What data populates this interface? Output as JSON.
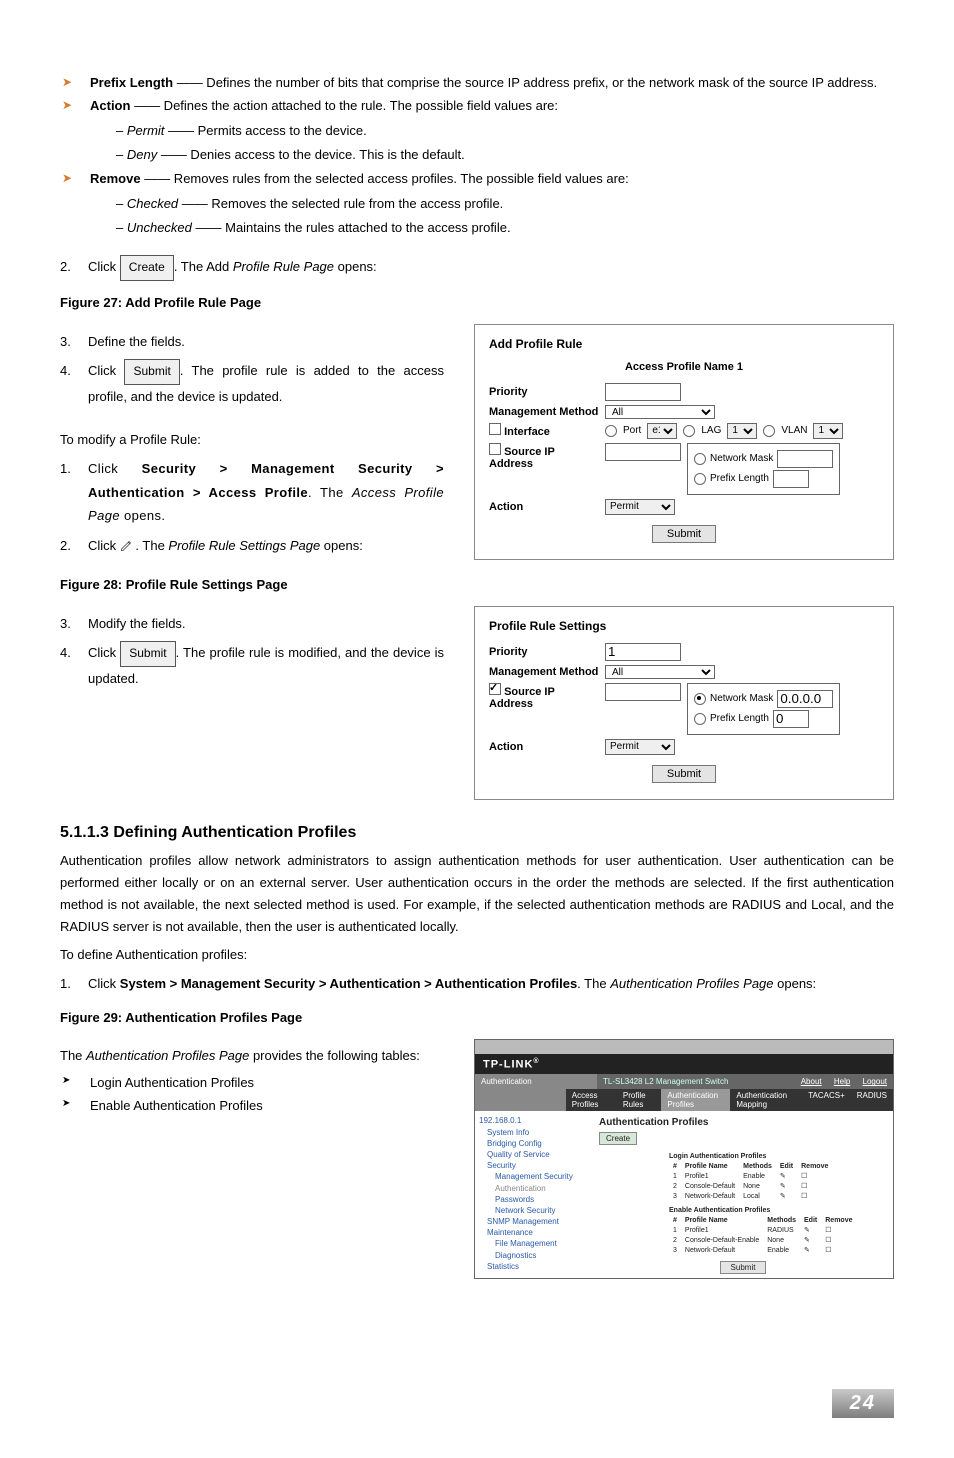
{
  "bullets": {
    "prefix_length_label": "Prefix Length",
    "prefix_length_text": " —— Defines the number of bits that comprise the source IP address prefix, or the network mask of the source IP address.",
    "action_label": "Action",
    "action_text": " —— Defines the action attached to the rule. The possible field values are:",
    "permit_line": "– Permit —— Permits access to the device.",
    "deny_line": "– Deny —— Denies access to the device. This is the default.",
    "remove_label": "Remove",
    "remove_text": " —— Removes rules from the selected access profiles. The possible field values are:",
    "checked_line": "– Checked —— Removes the selected rule from the access profile.",
    "unchecked_line": "– Unchecked —— Maintains the rules attached to the access profile."
  },
  "step2a_pre": "Click ",
  "create_btn": "Create",
  "step2a_post": ". The Add Profile Rule Page opens:",
  "fig27": "Figure 27: Add Profile Rule Page",
  "panel1": {
    "title": "Add Profile Rule",
    "subtitle": "Access Profile Name 1",
    "priority": "Priority",
    "mgmt": "Management Method",
    "mgmt_val": "All",
    "iface": "Interface",
    "port": "Port",
    "port_val": "e1",
    "lag": "LAG",
    "lag_val": "1",
    "vlan": "VLAN",
    "vlan_val": "1",
    "srcip": "Source IP Address",
    "netmask": "Network Mask",
    "preflen": "Prefix Length",
    "action": "Action",
    "action_val": "Permit",
    "submit": "Submit"
  },
  "step3": "Define the fields.",
  "step4a_pre": "Click ",
  "submit_btn": "Submit",
  "step4a_post": ". The profile rule is added to the access profile, and the device is updated.",
  "modify_intro": "To modify a Profile Rule:",
  "mod1_pre": "Click ",
  "mod1_bold": "Security > Management Security > Authentication > Access Profile",
  "mod1_post": ". The Access Profile Page opens.",
  "mod2_pre": "Click ",
  "mod2_post": " . The Profile Rule Settings Page opens:",
  "fig28": "Figure 28: Profile Rule Settings Page",
  "panel2": {
    "title": "Profile Rule Settings",
    "priority": "Priority",
    "priority_val": "1",
    "mgmt": "Management Method",
    "mgmt_val": "All",
    "srcip": "Source IP Address",
    "netmask": "Network Mask",
    "netmask_val": "0.0.0.0",
    "preflen": "Prefix Length",
    "preflen_val": "0",
    "action": "Action",
    "action_val": "Permit",
    "submit": "Submit"
  },
  "mod3": "Modify the fields.",
  "mod4_post": ". The profile rule is modified, and the device is updated.",
  "sec_heading": "5.1.1.3  Defining Authentication Profiles",
  "sec_para": "Authentication profiles allow network administrators to assign authentication methods for user authentication. User authentication can be performed either locally or on an external server. User authentication occurs in the order the methods are selected. If the first authentication method is not available, the next selected method is used. For example, if the selected authentication methods are RADIUS and Local, and the RADIUS server is not available, then the user is authenticated locally.",
  "define_intro": "To define Authentication profiles:",
  "def1_pre": "Click ",
  "def1_bold": "System > Management Security > Authentication > Authentication Profiles",
  "def1_post": ". The Authentication Profiles Page opens:",
  "fig29": "Figure 29: Authentication Profiles Page",
  "auth_para": "The Authentication Profiles Page provides the following tables:",
  "auth_b1": "Login Authentication Profiles",
  "auth_b2": "Enable Authentication Profiles",
  "shot": {
    "brand": "TP-LINK",
    "devmodel": "TL-SL3428 L2 Management Switch",
    "hdr_left": "Authentication",
    "tab1": "Access Profiles",
    "tab2": "Profile Rules",
    "tab3": "Authentication Profiles",
    "tab4": "Authentication Mapping",
    "tab5": "TACACS+",
    "tab6": "RADIUS",
    "about": "About",
    "help": "Help",
    "logout": "Logout",
    "tree_root": "192.168.0.1",
    "tree": [
      "System Info",
      "Bridging Config",
      "Quality of Service",
      "Security",
      "Management Security",
      "Authentication",
      "Passwords",
      "Network Security",
      "SNMP Management",
      "Maintenance",
      "File Management",
      "Diagnostics",
      "Statistics"
    ],
    "main_title": "Authentication Profiles",
    "create": "Create",
    "t1_title": "Login Authentication Profiles",
    "t1_cols": [
      "#",
      "Profile Name",
      "Methods",
      "Edit",
      "Remove"
    ],
    "t1_rows": [
      [
        "1",
        "Profile1",
        "Enable",
        "",
        ""
      ],
      [
        "2",
        "Console-Default",
        "None",
        "",
        ""
      ],
      [
        "3",
        "Network-Default",
        "Local",
        "",
        ""
      ]
    ],
    "t2_title": "Enable Authentication Profiles",
    "t2_cols": [
      "#",
      "Profile Name",
      "Methods",
      "Edit",
      "Remove"
    ],
    "t2_rows": [
      [
        "1",
        "Profile1",
        "RADIUS",
        "",
        ""
      ],
      [
        "2",
        "Console-Default-Enable",
        "None",
        "",
        ""
      ],
      [
        "3",
        "Network-Default",
        "Enable",
        "",
        ""
      ]
    ],
    "submit": "Submit"
  },
  "page_num": "24"
}
